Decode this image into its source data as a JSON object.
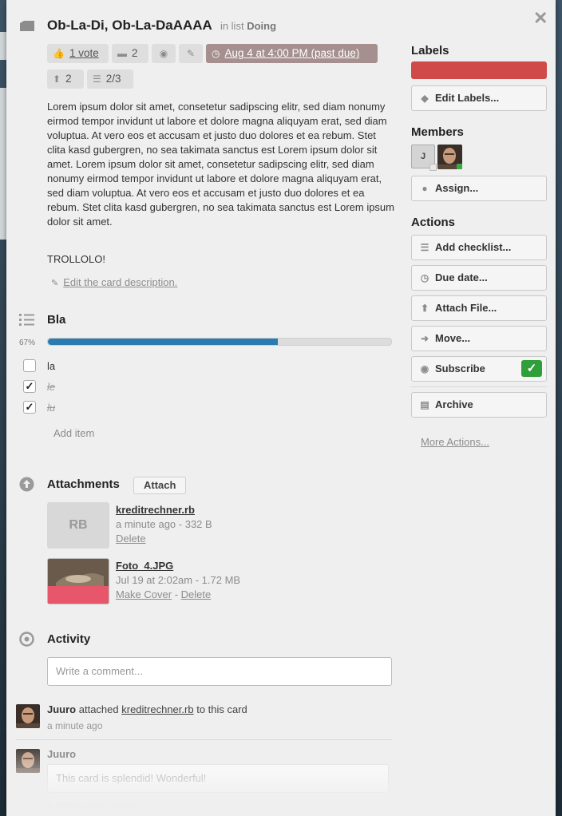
{
  "card": {
    "title": "Ob-La-Di, Ob-La-DaAAAA",
    "in_list_prefix": "in list",
    "list_name": "Doing"
  },
  "badges": {
    "votes": "1 vote",
    "comments": "2",
    "due": "Aug 4 at 4:00 PM (past due)",
    "attachments": "2",
    "checklist": "2/3"
  },
  "description": {
    "text": "Lorem ipsum dolor sit amet, consetetur sadipscing elitr, sed diam nonumy eirmod tempor invidunt ut labore et dolore magna aliquyam erat, sed diam voluptua. At vero eos et accusam et justo duo dolores et ea rebum. Stet clita kasd gubergren, no sea takimata sanctus est Lorem ipsum dolor sit amet. Lorem ipsum dolor sit amet, consetetur sadipscing elitr, sed diam nonumy eirmod tempor invidunt ut labore et dolore magna aliquyam erat, sed diam voluptua. At vero eos et accusam et justo duo dolores et ea rebum. Stet clita kasd gubergren, no sea takimata sanctus est Lorem ipsum dolor sit amet.",
    "extra": "TROLLOLO!",
    "edit_link": "Edit the card description."
  },
  "checklist": {
    "title": "Bla",
    "progress_label": "67%",
    "progress": 0.67,
    "items": [
      {
        "text": "la",
        "checked": false
      },
      {
        "text": "le",
        "checked": true
      },
      {
        "text": "lu",
        "checked": true
      }
    ],
    "add_item": "Add item"
  },
  "attachments": {
    "title": "Attachments",
    "attach_button": "Attach",
    "items": [
      {
        "thumb_text": "RB",
        "name": "kreditrechner.rb",
        "meta": "a minute ago - 332 B",
        "delete": "Delete"
      },
      {
        "name": "Foto_4.JPG",
        "meta": "Jul 19 at 2:02am - 1.72 MB",
        "make_cover": "Make Cover",
        "separator": "-",
        "delete": "Delete"
      }
    ]
  },
  "activity": {
    "title": "Activity",
    "comment_placeholder": "Write a comment...",
    "entries": [
      {
        "user": "Juuro",
        "action": "attached",
        "object": "kreditrechner.rb",
        "suffix": "to this card",
        "time": "a minute ago"
      },
      {
        "user": "Juuro",
        "comment": "This card is splendid! Wonderful!",
        "time": "a minute ago",
        "delete": "Delete"
      }
    ]
  },
  "sidebar": {
    "labels_title": "Labels",
    "label_color": "#d04a4a",
    "edit_labels": "Edit Labels...",
    "members_title": "Members",
    "member_initial": "J",
    "assign": "Assign...",
    "actions_title": "Actions",
    "add_checklist": "Add checklist...",
    "due_date": "Due date...",
    "attach_file": "Attach File...",
    "move": "Move...",
    "subscribe": "Subscribe",
    "archive": "Archive",
    "more_actions": "More Actions..."
  },
  "icons": {
    "close": "close-icon",
    "card": "card-icon",
    "vote": "thumbs-up-icon",
    "comment": "speech-bubble-icon",
    "watch": "eye-icon",
    "edit": "pencil-icon",
    "clock": "clock-icon",
    "attachment": "upload-icon",
    "checklist": "checklist-icon",
    "activity": "target-icon"
  }
}
